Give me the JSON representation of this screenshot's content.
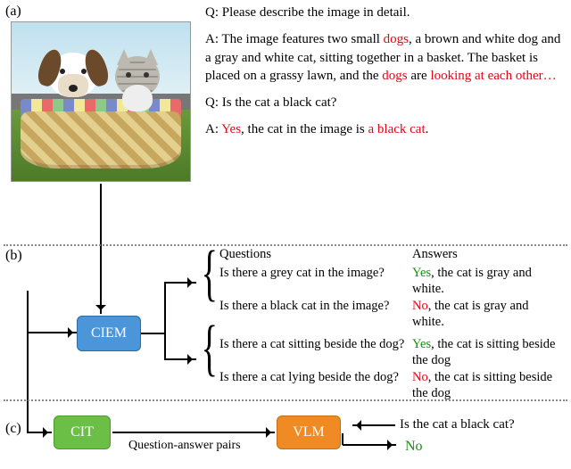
{
  "labels": {
    "a": "(a)",
    "b": "(b)",
    "c": "(c)"
  },
  "a": {
    "q1_prefix": "Q: ",
    "q1": "Please describe the image in detail.",
    "a_prefix": "A:  ",
    "a1_p1": "The image features two small ",
    "a1_r1": "dogs",
    "a1_p2": ", a brown and white dog and a gray and white cat, sitting together in a basket. The basket is placed on a grassy lawn, and the ",
    "a1_r2": "dogs",
    "a1_p3": " are ",
    "a1_r3": "looking at each other",
    "a1_r4": "…",
    "q2": "Is the cat a black cat?",
    "a2_r1": "Yes",
    "a2_p1": ", the cat in the image is ",
    "a2_r2": "a black cat",
    "a2_p2": "."
  },
  "b": {
    "ciem": "CIEM",
    "hdr_q": "Questions",
    "hdr_a": "Answers",
    "rows": [
      {
        "q": "Is there a grey cat in the image?",
        "a_key": "Yes",
        "a_rest": ", the cat is gray and white.",
        "key_color": "grn"
      },
      {
        "q": "Is there a black cat in the image?",
        "a_key": "No",
        "a_rest": ", the cat is gray and white.",
        "key_color": "red"
      },
      {
        "q": "Is there a cat sitting beside the dog?",
        "a_key": "Yes",
        "a_rest": ", the cat is sitting beside the dog",
        "key_color": "grn"
      },
      {
        "q": "Is there a cat lying beside the dog?",
        "a_key": "No",
        "a_rest": ", the cat is sitting beside the dog",
        "key_color": "red"
      }
    ]
  },
  "c": {
    "cit": "CIT",
    "vlm": "VLM",
    "edge_label": "Question-answer pairs",
    "in_q": "Is the cat a black cat?",
    "out_a": "No"
  }
}
